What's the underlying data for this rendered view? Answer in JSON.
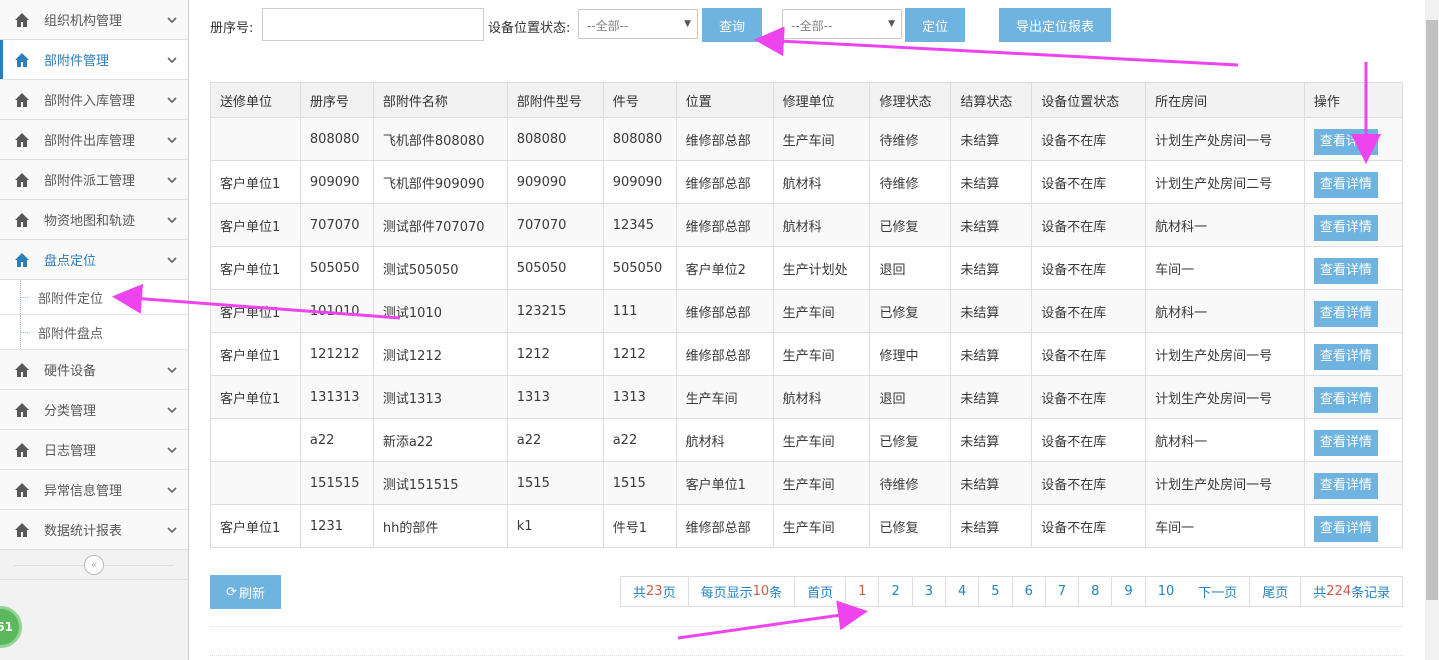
{
  "sidebar": {
    "items": [
      {
        "label": "组织机构管理"
      },
      {
        "label": "部附件管理"
      },
      {
        "label": "部附件入库管理"
      },
      {
        "label": "部附件出库管理"
      },
      {
        "label": "部附件派工管理"
      },
      {
        "label": "物资地图和轨迹"
      },
      {
        "label": "盘点定位"
      },
      {
        "label": "硬件设备"
      },
      {
        "label": "分类管理"
      },
      {
        "label": "日志管理"
      },
      {
        "label": "异常信息管理"
      },
      {
        "label": "数据统计报表"
      }
    ],
    "sub_items": [
      {
        "label": "部附件定位"
      },
      {
        "label": "部附件盘点"
      }
    ],
    "badge": "61"
  },
  "toolbar": {
    "register_label": "册序号:",
    "register_value": "",
    "status_label": "设备位置状态:",
    "status_select": "--全部--",
    "query_button": "查询",
    "locate_select": "--全部--",
    "locate_button": "定位",
    "export_button": "导出定位报表"
  },
  "table": {
    "headers": [
      "送修单位",
      "册序号",
      "部附件名称",
      "部附件型号",
      "件号",
      "位置",
      "修理单位",
      "修理状态",
      "结算状态",
      "设备位置状态",
      "所在房间",
      "操作"
    ],
    "detail_label": "查看详情",
    "rows": [
      [
        "",
        "808080",
        "飞机部件808080",
        "808080",
        "808080",
        "维修部总部",
        "生产车间",
        "待维修",
        "未结算",
        "设备不在库",
        "计划生产处房间一号"
      ],
      [
        "客户单位1",
        "909090",
        "飞机部件909090",
        "909090",
        "909090",
        "维修部总部",
        "航材科",
        "待维修",
        "未结算",
        "设备不在库",
        "计划生产处房间二号"
      ],
      [
        "客户单位1",
        "707070",
        "测试部件707070",
        "707070",
        "12345",
        "维修部总部",
        "航材科",
        "已修复",
        "未结算",
        "设备不在库",
        "航材科一"
      ],
      [
        "客户单位1",
        "505050",
        "测试505050",
        "505050",
        "505050",
        "客户单位2",
        "生产计划处",
        "退回",
        "未结算",
        "设备不在库",
        "车间一"
      ],
      [
        "客户单位1",
        "101010",
        "测试1010",
        "123215",
        "111",
        "维修部总部",
        "生产车间",
        "已修复",
        "未结算",
        "设备不在库",
        "航材科一"
      ],
      [
        "客户单位1",
        "121212",
        "测试1212",
        "1212",
        "1212",
        "维修部总部",
        "生产车间",
        "修理中",
        "未结算",
        "设备不在库",
        "计划生产处房间一号"
      ],
      [
        "客户单位1",
        "131313",
        "测试1313",
        "1313",
        "1313",
        "生产车间",
        "航材科",
        "退回",
        "未结算",
        "设备不在库",
        "计划生产处房间一号"
      ],
      [
        "",
        "a22",
        "新添a22",
        "a22",
        "a22",
        "航材科",
        "生产车间",
        "已修复",
        "未结算",
        "设备不在库",
        "航材科一"
      ],
      [
        "",
        "151515",
        "测试151515",
        "1515",
        "1515",
        "客户单位1",
        "生产车间",
        "待维修",
        "未结算",
        "设备不在库",
        "计划生产处房间一号"
      ],
      [
        "客户单位1",
        "1231",
        "hh的部件",
        "k1",
        "件号1",
        "维修部总部",
        "生产车间",
        "已修复",
        "未结算",
        "设备不在库",
        "车间一"
      ]
    ]
  },
  "footer": {
    "refresh_label": "刷新",
    "total_pages_prefix": "共",
    "total_pages": "23",
    "total_pages_suffix": " 页",
    "per_page_prefix": "每页显示",
    "per_page": "10",
    "per_page_suffix": "条",
    "first": "首页",
    "pages": [
      "1",
      "2",
      "3",
      "4",
      "5",
      "6",
      "7",
      "8",
      "9",
      "10"
    ],
    "current_page": "1",
    "next": "下一页",
    "last": "尾页",
    "total_records_prefix": "共",
    "total_records": "224",
    "total_records_suffix": "条记录"
  },
  "colors": {
    "accent": "#6fb3e0",
    "active_nav": "#2b7dbc",
    "annotation_arrow": "#ee44ee",
    "highlight": "#d15b47"
  }
}
